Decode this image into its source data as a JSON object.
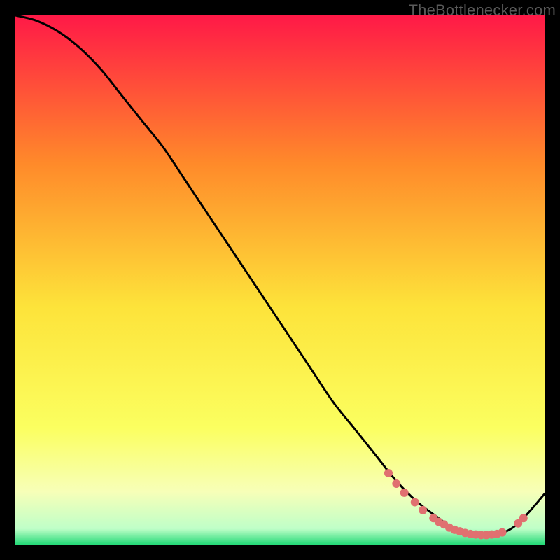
{
  "watermark": "TheBottlenecker.com",
  "chart_data": {
    "type": "line",
    "title": "",
    "xlabel": "",
    "ylabel": "",
    "xlim": [
      0,
      100
    ],
    "ylim": [
      0,
      100
    ],
    "grid": false,
    "legend": false,
    "background_gradient": {
      "top_color": "#ff1947",
      "mid_upper_color": "#ff8a2a",
      "mid_color": "#fde33a",
      "mid_lower_color": "#fbff60",
      "band_color": "#f7ffb8",
      "base_color": "#23d977"
    },
    "series": [
      {
        "name": "bottleneck-curve",
        "stroke": "#000000",
        "x": [
          0,
          4,
          8,
          12,
          16,
          20,
          24,
          28,
          32,
          36,
          40,
          44,
          48,
          52,
          56,
          60,
          64,
          68,
          72,
          76,
          80,
          82,
          84,
          86,
          88,
          90,
          92,
          94,
          96,
          98,
          100
        ],
        "y": [
          100,
          99,
          97,
          94,
          90,
          85,
          80,
          75,
          69,
          63,
          57,
          51,
          45,
          39,
          33,
          27,
          22,
          17,
          12,
          8,
          5,
          3.5,
          2.5,
          2,
          1.8,
          1.8,
          2.2,
          3.2,
          5.0,
          7.2,
          9.6
        ]
      }
    ],
    "markers": {
      "name": "highlight-dots",
      "fill": "#e07070",
      "radius": 6,
      "points": [
        {
          "x": 70.5,
          "y": 13.5
        },
        {
          "x": 72.0,
          "y": 11.5
        },
        {
          "x": 73.5,
          "y": 9.8
        },
        {
          "x": 75.5,
          "y": 8.0
        },
        {
          "x": 77.0,
          "y": 6.5
        },
        {
          "x": 79.0,
          "y": 5.0
        },
        {
          "x": 80.0,
          "y": 4.3
        },
        {
          "x": 81.0,
          "y": 3.8
        },
        {
          "x": 82.0,
          "y": 3.2
        },
        {
          "x": 83.0,
          "y": 2.8
        },
        {
          "x": 84.0,
          "y": 2.5
        },
        {
          "x": 85.0,
          "y": 2.2
        },
        {
          "x": 86.0,
          "y": 2.0
        },
        {
          "x": 87.0,
          "y": 1.9
        },
        {
          "x": 88.0,
          "y": 1.8
        },
        {
          "x": 89.0,
          "y": 1.8
        },
        {
          "x": 90.0,
          "y": 1.9
        },
        {
          "x": 91.0,
          "y": 2.0
        },
        {
          "x": 92.0,
          "y": 2.3
        },
        {
          "x": 95.0,
          "y": 4.0
        },
        {
          "x": 96.0,
          "y": 5.0
        }
      ]
    }
  }
}
